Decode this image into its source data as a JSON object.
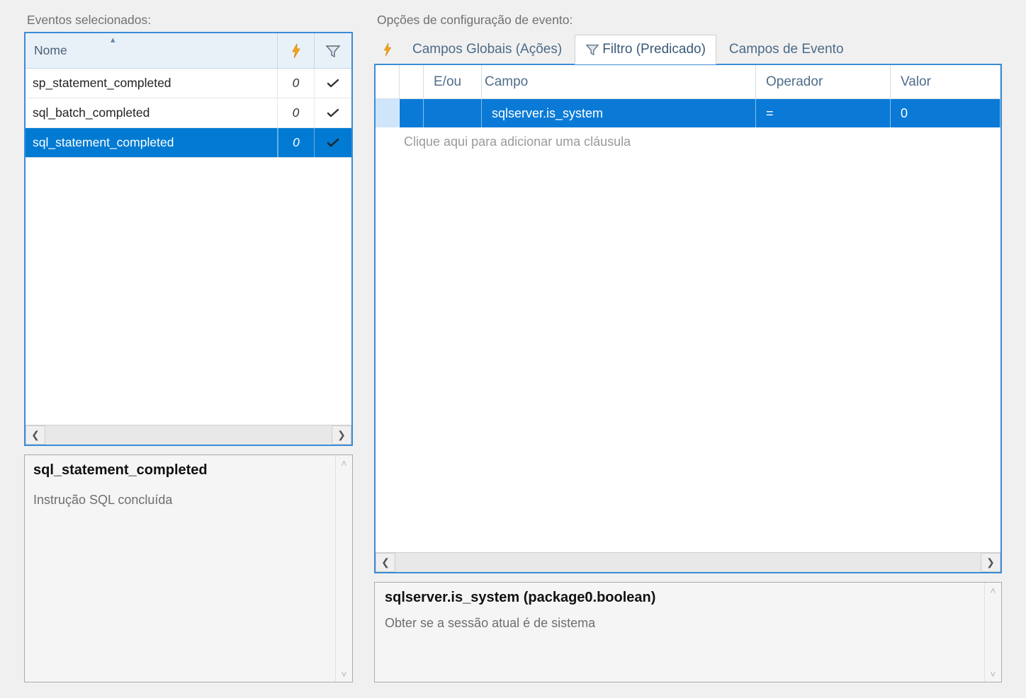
{
  "left": {
    "section_label": "Eventos selecionados:",
    "header": {
      "name": "Nome"
    },
    "rows": [
      {
        "name": "sp_statement_completed",
        "action_count": "0",
        "has_filter": true,
        "selected": false
      },
      {
        "name": "sql_batch_completed",
        "action_count": "0",
        "has_filter": true,
        "selected": false
      },
      {
        "name": "sql_statement_completed",
        "action_count": "0",
        "has_filter": true,
        "selected": true
      }
    ],
    "info": {
      "title": "sql_statement_completed",
      "desc": "Instrução SQL concluída"
    }
  },
  "right": {
    "section_label": "Opções de configuração de evento:",
    "tabs": {
      "globals": "Campos Globais (Ações)",
      "filter": "Filtro (Predicado)",
      "fields": "Campos de Evento",
      "active": "filter"
    },
    "grid": {
      "header": {
        "andor": "E/ou",
        "campo": "Campo",
        "op": "Operador",
        "val": "Valor"
      },
      "rows": [
        {
          "campo": "sqlserver.is_system",
          "op": "=",
          "val": "0"
        }
      ],
      "placeholder": "Clique aqui para adicionar uma cláusula"
    },
    "info": {
      "title": "sqlserver.is_system (package0.boolean)",
      "desc": "Obter se a sessão atual é de sistema"
    }
  }
}
